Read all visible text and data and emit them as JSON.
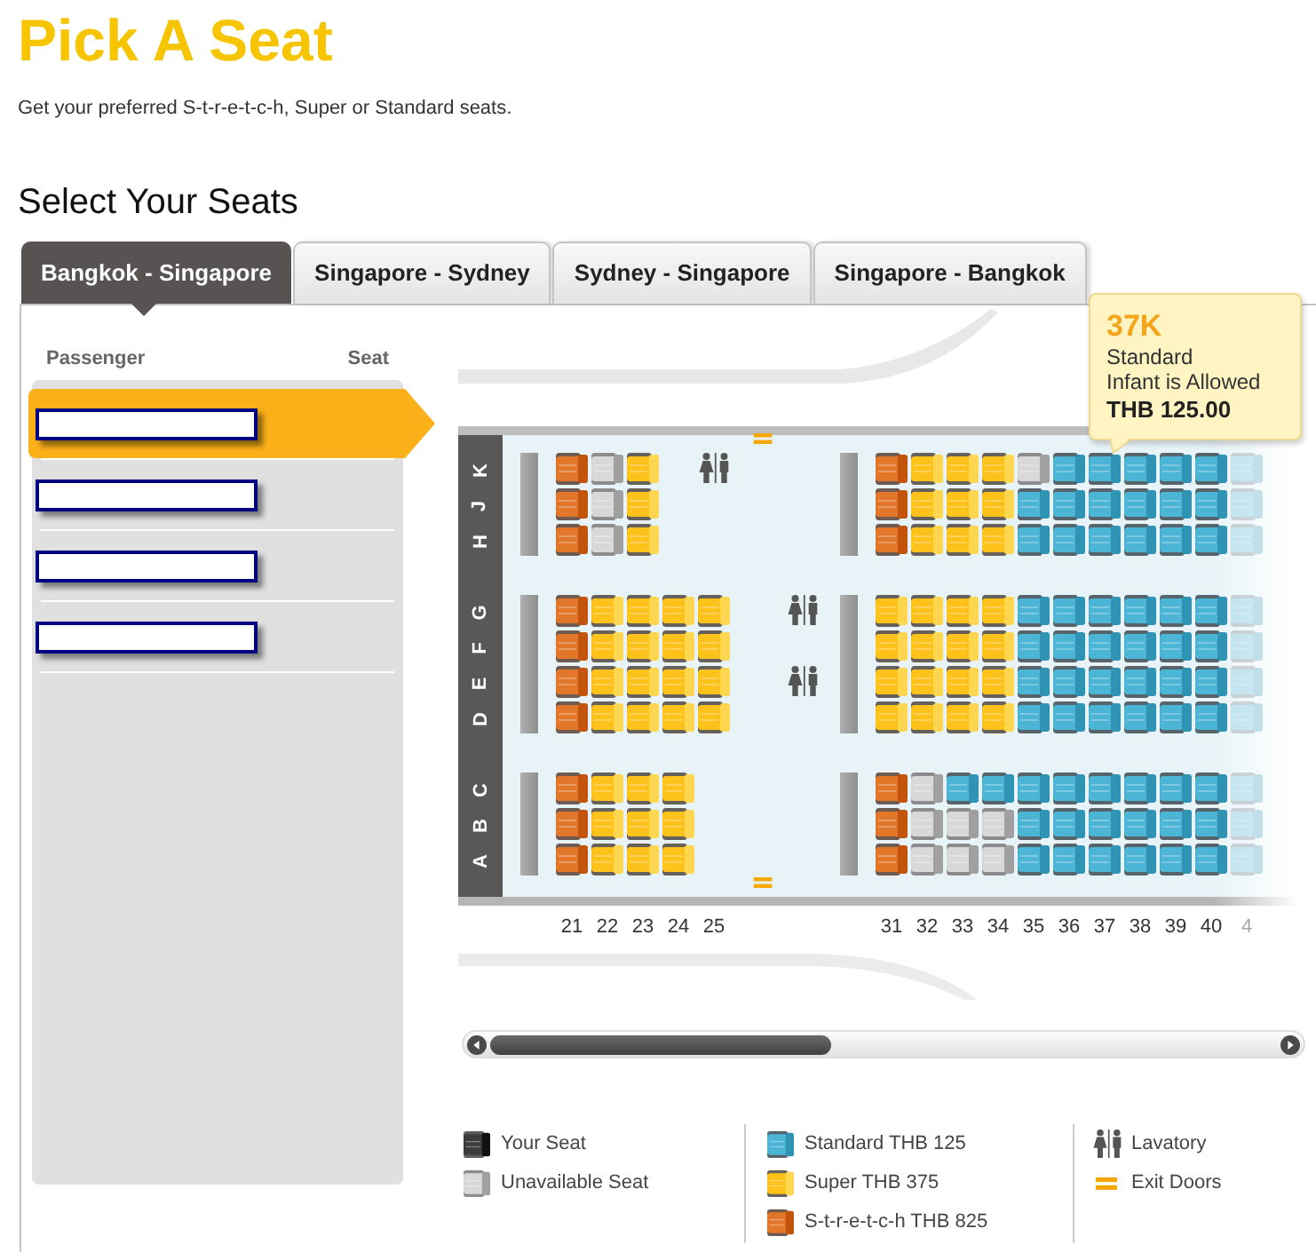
{
  "title": "Pick A Seat",
  "subtitle": "Get your preferred S-t-r-e-t-c-h, Super or Standard seats.",
  "section_heading": "Select Your Seats",
  "tabs": [
    {
      "label": "Bangkok - Singapore",
      "selected": true
    },
    {
      "label": "Singapore - Sydney",
      "selected": false
    },
    {
      "label": "Sydney - Singapore",
      "selected": false
    },
    {
      "label": "Singapore - Bangkok",
      "selected": false
    }
  ],
  "passenger_panel": {
    "columns": [
      "Passenger",
      "Seat"
    ],
    "passengers": [
      {
        "selected": true
      },
      {
        "selected": false
      },
      {
        "selected": false
      },
      {
        "selected": false
      }
    ]
  },
  "seat_map": {
    "row_groups": [
      [
        "K",
        "J",
        "H"
      ],
      [
        "G",
        "F",
        "E",
        "D"
      ],
      [
        "C",
        "B",
        "A"
      ]
    ],
    "sections": [
      {
        "kind": "cabin",
        "columns": [
          {
            "number": "21",
            "faded": false
          },
          {
            "number": "22",
            "faded": false
          },
          {
            "number": "23",
            "faded": false
          },
          {
            "number": "24",
            "faded": false
          },
          {
            "number": "25",
            "faded": false
          }
        ],
        "blocks": [
          [
            [
              {
                "kind": "stretch"
              },
              {
                "kind": "unavailable"
              },
              {
                "kind": "super"
              },
              {
                "kind": "empty"
              },
              {
                "kind": "lavatory"
              }
            ],
            [
              {
                "kind": "stretch"
              },
              {
                "kind": "unavailable"
              },
              {
                "kind": "super"
              }
            ],
            [
              {
                "kind": "stretch"
              },
              {
                "kind": "unavailable"
              },
              {
                "kind": "super"
              }
            ]
          ],
          [
            [
              {
                "kind": "stretch"
              },
              {
                "kind": "super"
              },
              {
                "kind": "super"
              },
              {
                "kind": "super"
              },
              {
                "kind": "super"
              }
            ],
            [
              {
                "kind": "stretch"
              },
              {
                "kind": "super"
              },
              {
                "kind": "super"
              },
              {
                "kind": "super"
              },
              {
                "kind": "super"
              }
            ],
            [
              {
                "kind": "stretch"
              },
              {
                "kind": "super"
              },
              {
                "kind": "super"
              },
              {
                "kind": "super"
              },
              {
                "kind": "super"
              }
            ],
            [
              {
                "kind": "stretch"
              },
              {
                "kind": "super"
              },
              {
                "kind": "super"
              },
              {
                "kind": "super"
              },
              {
                "kind": "super"
              }
            ]
          ],
          [
            [
              {
                "kind": "stretch"
              },
              {
                "kind": "super"
              },
              {
                "kind": "super"
              },
              {
                "kind": "super"
              }
            ],
            [
              {
                "kind": "stretch"
              },
              {
                "kind": "super"
              },
              {
                "kind": "super"
              },
              {
                "kind": "super"
              }
            ],
            [
              {
                "kind": "stretch"
              },
              {
                "kind": "super"
              },
              {
                "kind": "super"
              },
              {
                "kind": "super"
              }
            ]
          ]
        ]
      },
      {
        "kind": "galley",
        "exit_doors": true,
        "blocks": [
          [
            [
              {
                "kind": "empty"
              }
            ],
            [
              {
                "kind": "empty"
              }
            ],
            [
              {
                "kind": "empty"
              }
            ]
          ],
          [
            [
              {
                "kind": "lavatory"
              }
            ],
            [
              {
                "kind": "empty"
              }
            ],
            [
              {
                "kind": "lavatory"
              }
            ],
            [
              {
                "kind": "empty"
              }
            ]
          ],
          [
            [
              {
                "kind": "empty"
              }
            ],
            [
              {
                "kind": "empty"
              }
            ],
            [
              {
                "kind": "empty"
              }
            ]
          ]
        ]
      },
      {
        "kind": "cabin",
        "columns": [
          {
            "number": "31",
            "faded": false
          },
          {
            "number": "32",
            "faded": false
          },
          {
            "number": "33",
            "faded": false
          },
          {
            "number": "34",
            "faded": false
          },
          {
            "number": "35",
            "faded": false
          },
          {
            "number": "36",
            "faded": false
          },
          {
            "number": "37",
            "faded": false
          },
          {
            "number": "38",
            "faded": false
          },
          {
            "number": "39",
            "faded": false
          },
          {
            "number": "40",
            "faded": false
          },
          {
            "number": "4",
            "faded": true
          }
        ],
        "blocks": [
          [
            [
              {
                "kind": "stretch"
              },
              {
                "kind": "super"
              },
              {
                "kind": "super"
              },
              {
                "kind": "super"
              },
              {
                "kind": "unavailable"
              },
              {
                "kind": "standard"
              },
              {
                "kind": "standard"
              },
              {
                "kind": "standard"
              },
              {
                "kind": "standard"
              },
              {
                "kind": "standard"
              },
              {
                "kind": "standard"
              }
            ],
            [
              {
                "kind": "stretch"
              },
              {
                "kind": "super"
              },
              {
                "kind": "super"
              },
              {
                "kind": "super"
              },
              {
                "kind": "standard"
              },
              {
                "kind": "standard"
              },
              {
                "kind": "standard"
              },
              {
                "kind": "standard"
              },
              {
                "kind": "standard"
              },
              {
                "kind": "standard"
              },
              {
                "kind": "standard"
              }
            ],
            [
              {
                "kind": "stretch"
              },
              {
                "kind": "super"
              },
              {
                "kind": "super"
              },
              {
                "kind": "super"
              },
              {
                "kind": "standard"
              },
              {
                "kind": "standard"
              },
              {
                "kind": "standard"
              },
              {
                "kind": "standard"
              },
              {
                "kind": "standard"
              },
              {
                "kind": "standard"
              },
              {
                "kind": "standard"
              }
            ]
          ],
          [
            [
              {
                "kind": "super"
              },
              {
                "kind": "super"
              },
              {
                "kind": "super"
              },
              {
                "kind": "super"
              },
              {
                "kind": "standard"
              },
              {
                "kind": "standard"
              },
              {
                "kind": "standard"
              },
              {
                "kind": "standard"
              },
              {
                "kind": "standard"
              },
              {
                "kind": "standard"
              },
              {
                "kind": "standard"
              }
            ],
            [
              {
                "kind": "super"
              },
              {
                "kind": "super"
              },
              {
                "kind": "super"
              },
              {
                "kind": "super"
              },
              {
                "kind": "standard"
              },
              {
                "kind": "standard"
              },
              {
                "kind": "standard"
              },
              {
                "kind": "standard"
              },
              {
                "kind": "standard"
              },
              {
                "kind": "standard"
              },
              {
                "kind": "standard"
              }
            ],
            [
              {
                "kind": "super"
              },
              {
                "kind": "super"
              },
              {
                "kind": "super"
              },
              {
                "kind": "super"
              },
              {
                "kind": "standard"
              },
              {
                "kind": "standard"
              },
              {
                "kind": "standard"
              },
              {
                "kind": "standard"
              },
              {
                "kind": "standard"
              },
              {
                "kind": "standard"
              },
              {
                "kind": "standard"
              }
            ],
            [
              {
                "kind": "super"
              },
              {
                "kind": "super"
              },
              {
                "kind": "super"
              },
              {
                "kind": "super"
              },
              {
                "kind": "standard"
              },
              {
                "kind": "standard"
              },
              {
                "kind": "standard"
              },
              {
                "kind": "standard"
              },
              {
                "kind": "standard"
              },
              {
                "kind": "standard"
              },
              {
                "kind": "standard"
              }
            ]
          ],
          [
            [
              {
                "kind": "stretch"
              },
              {
                "kind": "unavailable"
              },
              {
                "kind": "standard"
              },
              {
                "kind": "standard"
              },
              {
                "kind": "standard"
              },
              {
                "kind": "standard"
              },
              {
                "kind": "standard"
              },
              {
                "kind": "standard"
              },
              {
                "kind": "standard"
              },
              {
                "kind": "standard"
              },
              {
                "kind": "standard"
              }
            ],
            [
              {
                "kind": "stretch"
              },
              {
                "kind": "unavailable"
              },
              {
                "kind": "unavailable"
              },
              {
                "kind": "unavailable"
              },
              {
                "kind": "standard"
              },
              {
                "kind": "standard"
              },
              {
                "kind": "standard"
              },
              {
                "kind": "standard"
              },
              {
                "kind": "standard"
              },
              {
                "kind": "standard"
              },
              {
                "kind": "standard"
              }
            ],
            [
              {
                "kind": "stretch"
              },
              {
                "kind": "unavailable"
              },
              {
                "kind": "unavailable"
              },
              {
                "kind": "unavailable"
              },
              {
                "kind": "standard"
              },
              {
                "kind": "standard"
              },
              {
                "kind": "standard"
              },
              {
                "kind": "standard"
              },
              {
                "kind": "standard"
              },
              {
                "kind": "standard"
              },
              {
                "kind": "standard"
              }
            ]
          ]
        ]
      }
    ],
    "tooltip": {
      "seat": "37K",
      "type": "Standard",
      "note": "Infant is Allowed",
      "price": "THB 125.00"
    }
  },
  "legend": [
    {
      "items": [
        {
          "kind": "your_seat",
          "label": "Your Seat"
        },
        {
          "kind": "unavailable",
          "label": "Unavailable Seat"
        }
      ]
    },
    {
      "items": [
        {
          "kind": "standard",
          "label": "Standard THB 125"
        },
        {
          "kind": "super",
          "label": "Super THB 375"
        },
        {
          "kind": "stretch",
          "label": "S-t-r-e-t-c-h THB 825"
        }
      ]
    },
    {
      "items": [
        {
          "kind": "lavatory",
          "label": "Lavatory"
        },
        {
          "kind": "exit_door",
          "label": "Exit Doors"
        }
      ]
    }
  ]
}
